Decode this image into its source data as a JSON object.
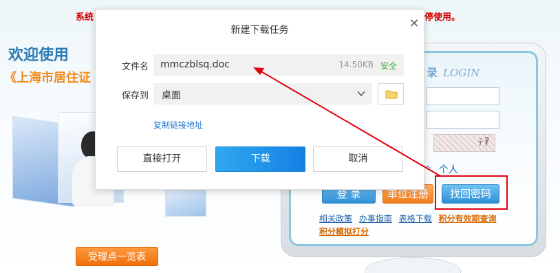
{
  "background": {
    "notice_left": "系统",
    "notice_right": "暂停使用。",
    "welcome": "欢迎使用",
    "subtitle": "《上海市居住证",
    "list_button": "受理点一览表",
    "login": {
      "title_cn": "录",
      "title_en": "LOGIN",
      "user_type": "个人",
      "login_button": "登 录",
      "register_button": "单位注册",
      "find_password_button": "找回密码",
      "links": [
        "相关政策",
        "办事指南",
        "表格下载"
      ],
      "links_hot": "积分有效期查询",
      "link_sim": "积分模拟打分"
    }
  },
  "dialog": {
    "title": "新建下载任务",
    "filename_label": "文件名",
    "filename": "mmczblsq.doc",
    "filesize": "14.50KB",
    "safe": "安全",
    "saveto_label": "保存到",
    "saveto": "桌面",
    "copy_link": "复制链接地址",
    "open_button": "直接打开",
    "download_button": "下载",
    "cancel_button": "取消"
  },
  "icons": [
    "close-icon",
    "chevron-down-icon",
    "folder-icon",
    "annotation-arrow"
  ],
  "colors": {
    "accent_blue": "#1680e3",
    "safe_green": "#3cae3c",
    "annotation_red": "#e0000e",
    "notice_red": "#d40000"
  }
}
